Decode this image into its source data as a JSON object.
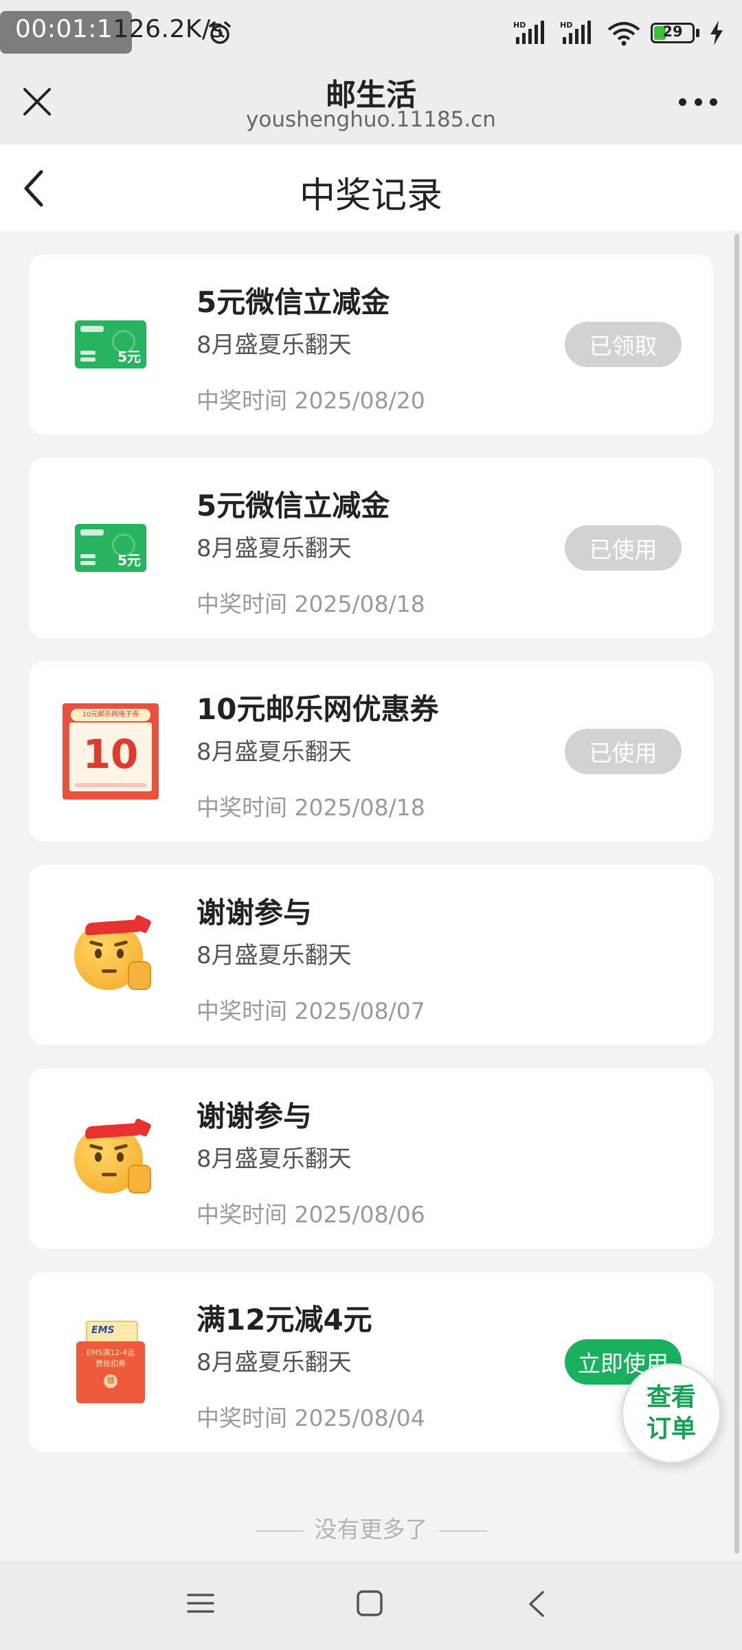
{
  "status_bar": {
    "timer": "00:01:1",
    "speed": "126.2K/s",
    "signal1_label": "HD",
    "signal2_label": "HD",
    "battery": "29"
  },
  "browser": {
    "title": "邮生活",
    "url": "youshenghuo.11185.cn"
  },
  "page": {
    "title": "中奖记录"
  },
  "records": [
    {
      "title": "5元微信立减金",
      "activity": "8月盛夏乐翻天",
      "time": "中奖时间 2025/08/20",
      "status": "已领取",
      "status_style": "gray",
      "thumb": "wechat-voucher",
      "thumb_amount": "5元"
    },
    {
      "title": "5元微信立减金",
      "activity": "8月盛夏乐翻天",
      "time": "中奖时间 2025/08/18",
      "status": "已使用",
      "status_style": "gray",
      "thumb": "wechat-voucher",
      "thumb_amount": "5元"
    },
    {
      "title": "10元邮乐网优惠券",
      "activity": "8月盛夏乐翻天",
      "time": "中奖时间 2025/08/18",
      "status": "已使用",
      "status_style": "gray",
      "thumb": "youle-coupon",
      "thumb_header": "10元邮乐网电子券",
      "thumb_amount": "10"
    },
    {
      "title": "谢谢参与",
      "activity": "8月盛夏乐翻天",
      "time": "中奖时间 2025/08/07",
      "status": "",
      "thumb": "thanks-emoji"
    },
    {
      "title": "谢谢参与",
      "activity": "8月盛夏乐翻天",
      "time": "中奖时间 2025/08/06",
      "status": "",
      "thumb": "thanks-emoji"
    },
    {
      "title": "满12元减4元",
      "activity": "8月盛夏乐翻天",
      "time": "中奖时间 2025/08/04",
      "status": "立即使用",
      "status_style": "green",
      "thumb": "ems-envelope",
      "thumb_brand": "EMS",
      "thumb_text": "EMS满12-4运费抵扣券",
      "thumb_seal": "领"
    }
  ],
  "no_more_text": "没有更多了",
  "fab_label": "查看订单",
  "colors": {
    "accent": "#19b060",
    "badge_gray": "#d2d2d2",
    "background": "#f3f3f3"
  }
}
